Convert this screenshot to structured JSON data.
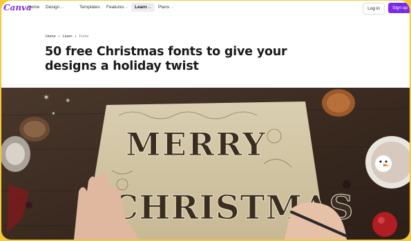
{
  "nav": {
    "logo": "Canva",
    "items": [
      {
        "label": "Home",
        "chevron": false
      },
      {
        "label": "Design",
        "chevron": true
      },
      {
        "label": "Templates",
        "chevron": false
      },
      {
        "label": "Features",
        "chevron": true
      },
      {
        "label": "Learn",
        "chevron": true,
        "active": true
      },
      {
        "label": "Plans",
        "chevron": true
      }
    ],
    "login": "Log in",
    "signup": "Sign up",
    "accent": "#7d2ae8"
  },
  "breadcrumb": {
    "items": [
      "Home",
      "Learn",
      "Fonts"
    ]
  },
  "article": {
    "title": "50 free Christmas fonts to give your designs a holiday twist"
  },
  "hero": {
    "icon": "merry-christmas-hand-lettering-photo",
    "lettering": [
      "MERRY",
      "CHRISTMAS"
    ]
  },
  "colors": {
    "frame_border": "#f4c93a",
    "brand": "#7d2ae8"
  }
}
